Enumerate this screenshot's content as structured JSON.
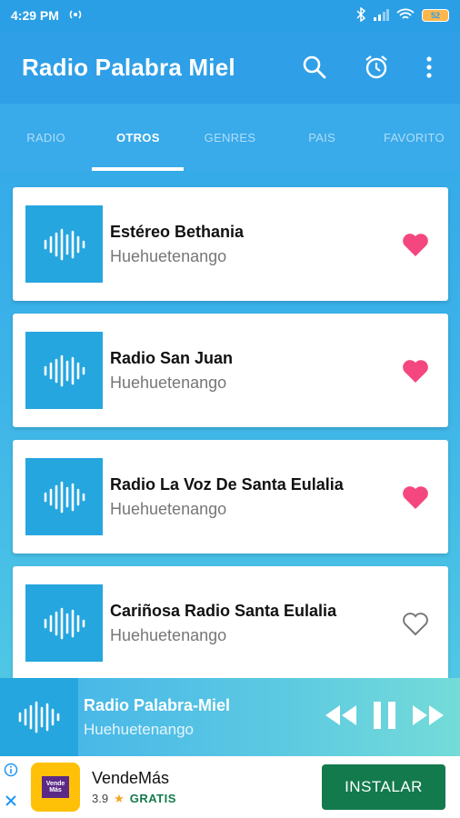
{
  "status": {
    "time": "4:29 PM",
    "battery": "52"
  },
  "app": {
    "title": "Radio Palabra Miel"
  },
  "tabs": [
    {
      "label": "RADIO",
      "active": false
    },
    {
      "label": "OTROS",
      "active": true
    },
    {
      "label": "GENRES",
      "active": false
    },
    {
      "label": "PAIS",
      "active": false
    },
    {
      "label": "FAVORITO",
      "active": false
    }
  ],
  "stations": [
    {
      "name": "Estéreo Bethania",
      "location": "Huehuetenango",
      "favorite": true
    },
    {
      "name": "Radio San Juan",
      "location": "Huehuetenango",
      "favorite": true
    },
    {
      "name": "Radio La Voz De Santa Eulalia",
      "location": "Huehuetenango",
      "favorite": true
    },
    {
      "name": "Cariñosa Radio Santa Eulalia",
      "location": "Huehuetenango",
      "favorite": false
    }
  ],
  "player": {
    "title": "Radio Palabra-Miel",
    "subtitle": "Huehuetenango"
  },
  "ad": {
    "logo_text": "Vende Más",
    "title": "VendeMás",
    "rating": "3.9",
    "price": "GRATIS",
    "button": "INSTALAR"
  },
  "colors": {
    "primary": "#2f9fe7",
    "accent_heart": "#f5477f",
    "thumb": "#25a6df",
    "ad_button": "#137a4d"
  }
}
